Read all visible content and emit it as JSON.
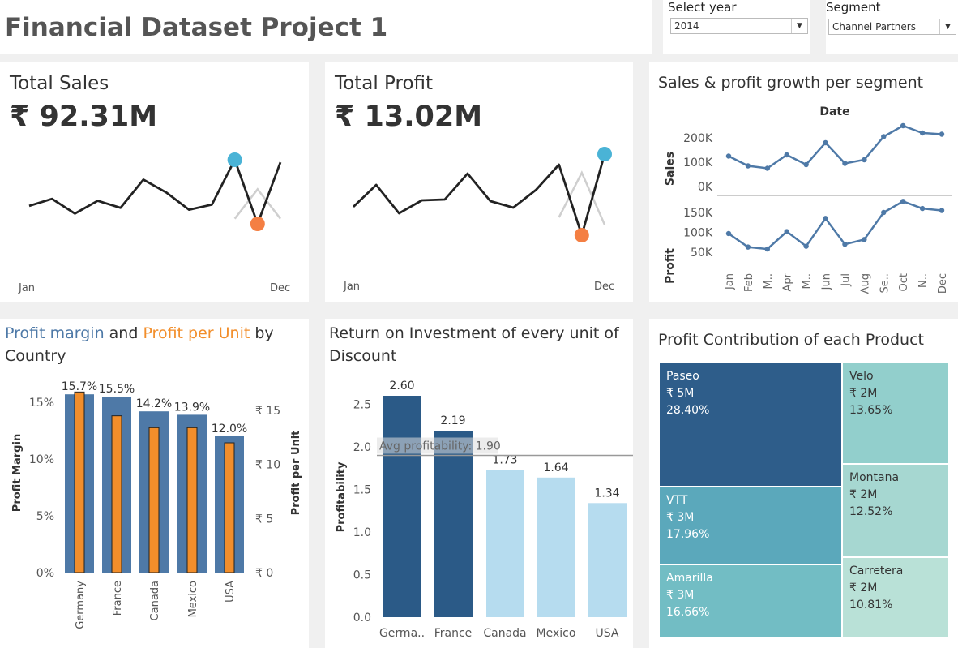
{
  "header": {
    "title": "Financial Dataset Project 1",
    "year_label": "Select year",
    "year_value": "2014",
    "segment_label": "Segment",
    "segment_value": "Channel Partners"
  },
  "kpi_sales": {
    "title": "Total Sales",
    "value": "₹ 92.31M",
    "x_start": "Jan",
    "x_end": "Dec",
    "current": [
      0.72,
      0.61,
      0.84,
      0.64,
      0.75,
      0.31,
      0.51,
      0.78,
      0.7,
      0.0,
      1.0,
      0.04
    ],
    "previous": [
      null,
      null,
      null,
      null,
      null,
      null,
      null,
      null,
      null,
      0.92,
      0.46,
      0.92
    ]
  },
  "kpi_profit": {
    "title": "Total Profit",
    "value": "₹ 13.02M",
    "x_start": "Jan",
    "x_end": "Dec",
    "current": [
      0.65,
      0.38,
      0.73,
      0.57,
      0.56,
      0.24,
      0.58,
      0.66,
      0.44,
      0.13,
      1.0,
      0.0
    ],
    "previous": [
      null,
      null,
      null,
      null,
      null,
      null,
      null,
      null,
      null,
      0.78,
      0.23,
      0.87
    ]
  },
  "colors": {
    "blue": "#4e79a7",
    "orange": "#f28e2b",
    "dark_blue": "#2b5a87",
    "light_blue": "#b6dcef",
    "teal1": "#2e5d8a",
    "teal2": "#5ba8bb",
    "teal3": "#72bdc4",
    "teal4": "#92cfcc",
    "teal5": "#a6d7d1",
    "teal6": "#b9e1d7",
    "sparkline_dot_blue": "#4ab3d6",
    "sparkline_dot_orange": "#f47f43"
  },
  "growth": {
    "title": "Sales & profit growth per segment",
    "date_label": "Date",
    "sales_label": "Sales",
    "profit_label": "Profit",
    "sales_ticks": [
      "200K",
      "100K",
      "0K"
    ],
    "profit_ticks": [
      "150K",
      "100K",
      "50K"
    ],
    "months": [
      "Jan",
      "Feb",
      "M..",
      "Apr",
      "M..",
      "Jun",
      "Jul",
      "Aug",
      "Se..",
      "Oct",
      "N..",
      "Dec"
    ]
  },
  "chart_data": [
    {
      "type": "line",
      "title": "Sales & profit growth per segment",
      "x": [
        "Jan",
        "Feb",
        "Mar",
        "Apr",
        "May",
        "Jun",
        "Jul",
        "Aug",
        "Sep",
        "Oct",
        "Nov",
        "Dec"
      ],
      "series": [
        {
          "name": "Sales",
          "values": [
            125000,
            85000,
            75000,
            130000,
            90000,
            180000,
            95000,
            110000,
            205000,
            250000,
            220000,
            215000
          ]
        },
        {
          "name": "Profit",
          "values": [
            97000,
            63000,
            58000,
            102000,
            65000,
            135000,
            70000,
            82000,
            150000,
            178000,
            160000,
            155000
          ]
        }
      ]
    },
    {
      "type": "bar",
      "title": "Profit margin and Profit per Unit by Country",
      "categories": [
        "Germany",
        "France",
        "Canada",
        "Mexico",
        "USA"
      ],
      "series": [
        {
          "name": "Profit margin",
          "values": [
            15.7,
            15.5,
            14.2,
            13.9,
            12.0
          ],
          "labels": [
            "15.7%",
            "15.5%",
            "14.2%",
            "13.9%",
            "12.0%"
          ]
        },
        {
          "name": "Profit per Unit",
          "values": [
            16.7,
            14.5,
            13.4,
            13.4,
            12.0
          ]
        }
      ],
      "ylabel": "Profit Margin",
      "y2label": "Profit per Unit",
      "yticks": [
        "15%",
        "10%",
        "5%",
        "0%"
      ],
      "y2ticks": [
        "₹ 15",
        "₹ 10",
        "₹ 5",
        "₹ 0"
      ]
    },
    {
      "type": "bar",
      "title": "Return on Investment of every unit of Discount",
      "categories": [
        "Germa..",
        "France",
        "Canada",
        "Mexico",
        "USA"
      ],
      "values": [
        2.6,
        2.19,
        1.73,
        1.64,
        1.34
      ],
      "labels": [
        "2.60",
        "2.19",
        "1.73",
        "1.64",
        "1.34"
      ],
      "ylabel": "Profitability",
      "yticks": [
        "2.5",
        "2.0",
        "1.5",
        "1.0",
        "0.5",
        "0.0"
      ],
      "reference_line": "Avg profitability: 1.90",
      "reference_value": 1.9
    },
    {
      "type": "treemap",
      "title": "Profit Contribution of each Product",
      "items": [
        {
          "name": "Paseo",
          "value": "₹ 5M",
          "pct": "28.40%"
        },
        {
          "name": "VTT",
          "value": "₹ 3M",
          "pct": "17.96%"
        },
        {
          "name": "Amarilla",
          "value": "₹ 3M",
          "pct": "16.66%"
        },
        {
          "name": "Velo",
          "value": "₹ 2M",
          "pct": "13.65%"
        },
        {
          "name": "Montana",
          "value": "₹ 2M",
          "pct": "12.52%"
        },
        {
          "name": "Carretera",
          "value": "₹ 2M",
          "pct": "10.81%"
        }
      ]
    }
  ],
  "margin_panel": {
    "title_part1": "Profit margin",
    "title_part2": " and ",
    "title_part3": "Profit per Unit",
    "title_part4": " by",
    "title_line2": "Country"
  },
  "roi_panel": {
    "title_line1": "Return on Investment of every unit of",
    "title_line2": "Discount"
  },
  "treemap_panel": {
    "title": "Profit Contribution of each Product"
  }
}
